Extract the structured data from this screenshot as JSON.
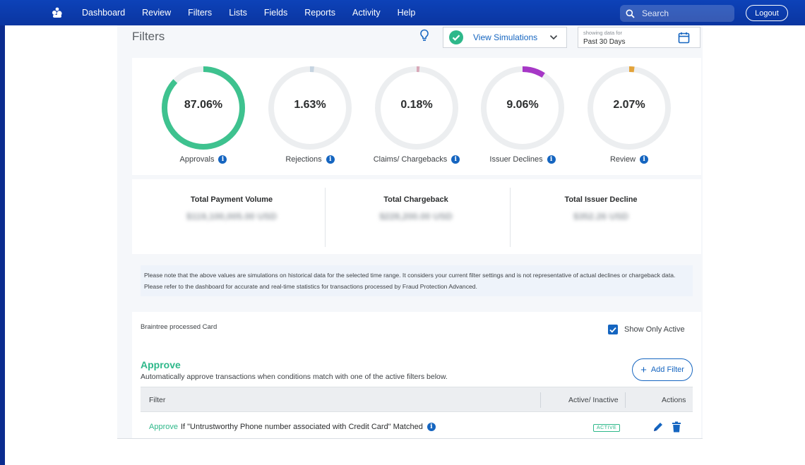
{
  "nav": {
    "logo": "app-logo-icon",
    "items": [
      "Dashboard",
      "Review",
      "Filters",
      "Lists",
      "Fields",
      "Reports",
      "Activity",
      "Help"
    ],
    "search_placeholder": "Search",
    "logout": "Logout"
  },
  "page": {
    "title": "Filters",
    "simulation_label": "View Simulations",
    "date_caption": "showing data for",
    "date_value": "Past 30 Days"
  },
  "gauges": [
    {
      "label": "Approvals",
      "value": "87.06%",
      "fraction": 0.8706,
      "color": "#3ec28f"
    },
    {
      "label": "Rejections",
      "value": "1.63%",
      "fraction": 0.0163,
      "color": "#c5d3e0"
    },
    {
      "label": "Claims/ Chargebacks",
      "value": "0.18%",
      "fraction": 0.0018,
      "color": "#d8a8b8"
    },
    {
      "label": "Issuer Declines",
      "value": "9.06%",
      "fraction": 0.0906,
      "color": "#a637c6"
    },
    {
      "label": "Review",
      "value": "2.07%",
      "fraction": 0.0207,
      "color": "#e3a33a"
    }
  ],
  "totals": [
    {
      "label": "Total Payment Volume",
      "value": "$119,100,005.00 USD"
    },
    {
      "label": "Total Chargeback",
      "value": "$228,200.00 USD"
    },
    {
      "label": "Total Issuer Decline",
      "value": "$352.26 USD"
    }
  ],
  "note": "Please note that the above values are simulations on historical data for the selected time range. It considers your current filter settings and is not representative of actual declines or chargeback data. Please refer to the dashboard for accurate and real-time statistics for transactions processed by Fraud Protection Advanced.",
  "filters": {
    "source": "Braintree processed Card",
    "show_only_active": "Show Only Active",
    "section_title": "Approve",
    "section_desc": "Automatically approve transactions when conditions match with one of the active filters below.",
    "add_filter": "Add Filter",
    "columns": [
      "Filter",
      "Active/ Inactive",
      "Actions"
    ],
    "rows": [
      {
        "action": "Approve",
        "condition": "If \"Untrustworthy Phone number associated with Credit Card\" Matched",
        "status": "ACTIVE"
      }
    ]
  },
  "colors": {
    "nav": "#0b3aa5",
    "accent": "#1565c0",
    "approve": "#2eb88a"
  }
}
